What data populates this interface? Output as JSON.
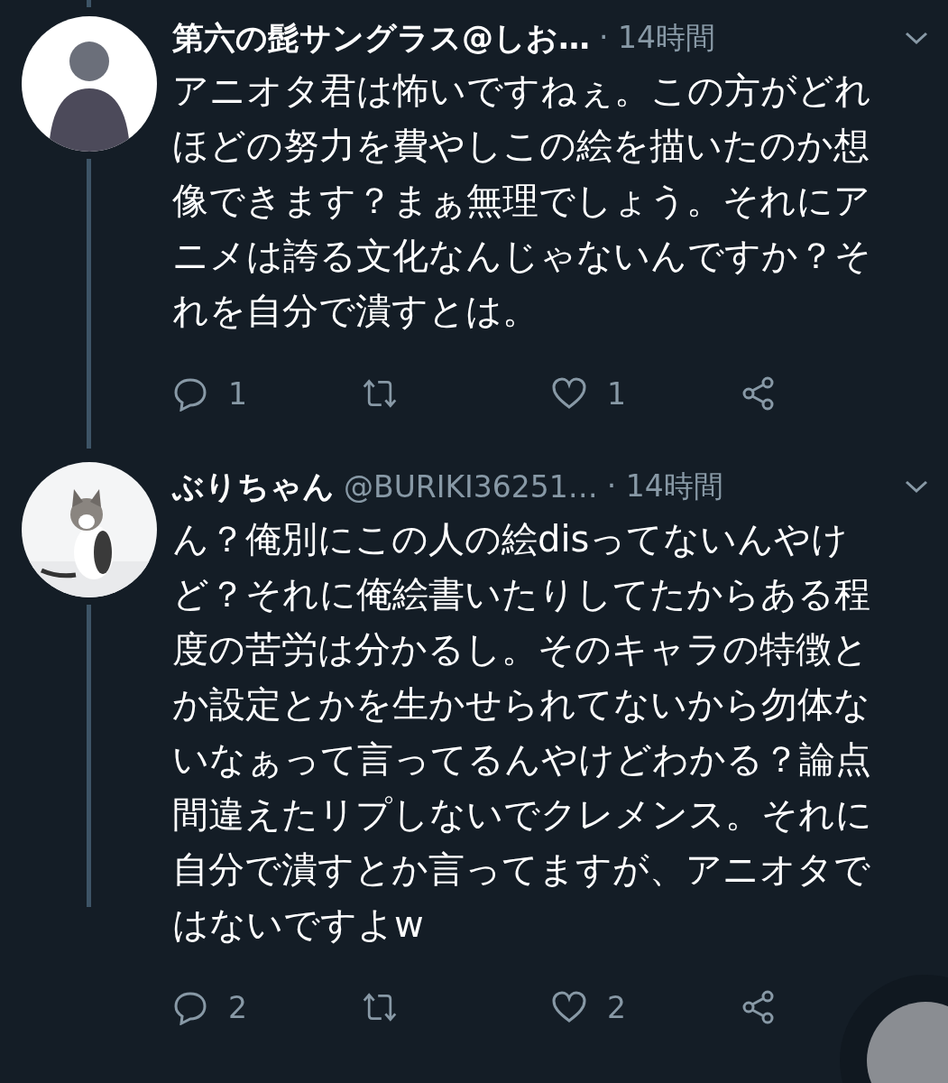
{
  "tweets": [
    {
      "avatar": {
        "kind": "figure"
      },
      "name": "第六の髭サングラス@しお…",
      "time": "· 14時間",
      "text": "アニオタ君は怖いですねぇ。この方がどれほどの努力を費やしこの絵を描いたのか想像できます？まぁ無理でしょう。それにアニメは誇る文化なんじゃないんですか？それを自分で潰すとは。",
      "replies": "1",
      "likes": "1"
    },
    {
      "name": "ぶりちゃん",
      "handle": "@BURIKI36251…",
      "time": "· 14時間",
      "text": "ん？俺別にこの人の絵disってないんやけど？それに俺絵書いたりしてたからある程度の苦労は分かるし。そのキャラの特徴とか設定とかを生かせられてないから勿体ないなぁって言ってるんやけどわかる？論点間違えたリプしないでクレメンス。それに自分で潰すとか言ってますが、アニオタではないですよw",
      "replies": "2",
      "likes": "2"
    }
  ]
}
